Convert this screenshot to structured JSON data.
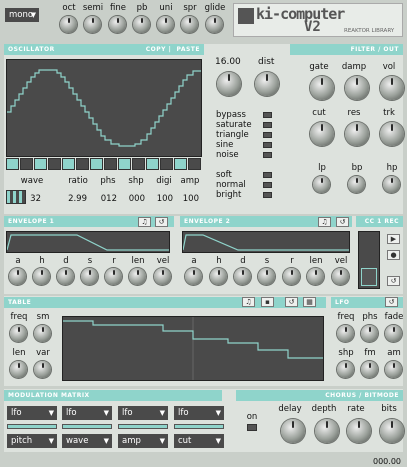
{
  "top": {
    "voice_mode": "mono",
    "knobs": [
      "oct",
      "semi",
      "fine",
      "pb",
      "uni",
      "spr",
      "glide"
    ],
    "brand_title": "ki-computer",
    "brand_version": "V2",
    "brand_sub": "REAKTOR LIBRARY"
  },
  "osc": {
    "header": "OSCILLATOR",
    "copy": "COPY",
    "paste": "PASTE",
    "right_header": "FILTER / OUT",
    "value": "16.00",
    "dist_label": "dist",
    "modes": [
      "bypass",
      "saturate",
      "triangle",
      "sine",
      "noise"
    ],
    "shapes": [
      "soft",
      "normal",
      "bright"
    ],
    "params": [
      {
        "label": "wave",
        "value": "32"
      },
      {
        "label": "ratio",
        "value": "2.99"
      },
      {
        "label": "phs",
        "value": "012"
      },
      {
        "label": "shp",
        "value": "000"
      },
      {
        "label": "digi",
        "value": "100"
      },
      {
        "label": "amp",
        "value": "100"
      }
    ]
  },
  "filter": {
    "row1": [
      "gate",
      "damp",
      "vol"
    ],
    "row2": [
      "cut",
      "res",
      "trk"
    ],
    "row3": [
      "lp",
      "bp",
      "hp"
    ]
  },
  "env1": {
    "header": "ENVELOPE 1",
    "knobs": [
      "a",
      "h",
      "d",
      "s",
      "r",
      "len",
      "vel"
    ]
  },
  "env2": {
    "header": "ENVELOPE 2",
    "knobs": [
      "a",
      "h",
      "d",
      "s",
      "r",
      "len",
      "vel"
    ]
  },
  "cc": {
    "header": "CC 1 REC"
  },
  "table": {
    "header": "TABLE",
    "knobs": [
      "freq",
      "sm",
      "len",
      "var"
    ]
  },
  "lfo": {
    "header": "LFO",
    "knobs": [
      "freq",
      "phs",
      "fade",
      "shp",
      "fm",
      "am"
    ]
  },
  "mod": {
    "header": "MODULATION MATRIX",
    "sources": [
      "lfo",
      "lfo",
      "lfo",
      "lfo"
    ],
    "targets": [
      "pitch",
      "wave",
      "amp",
      "cut"
    ]
  },
  "chorus": {
    "header": "CHORUS / BITMODE",
    "on": "on",
    "knobs": [
      "delay",
      "depth",
      "rate",
      "bits"
    ]
  },
  "status": {
    "readout": "000.00"
  }
}
